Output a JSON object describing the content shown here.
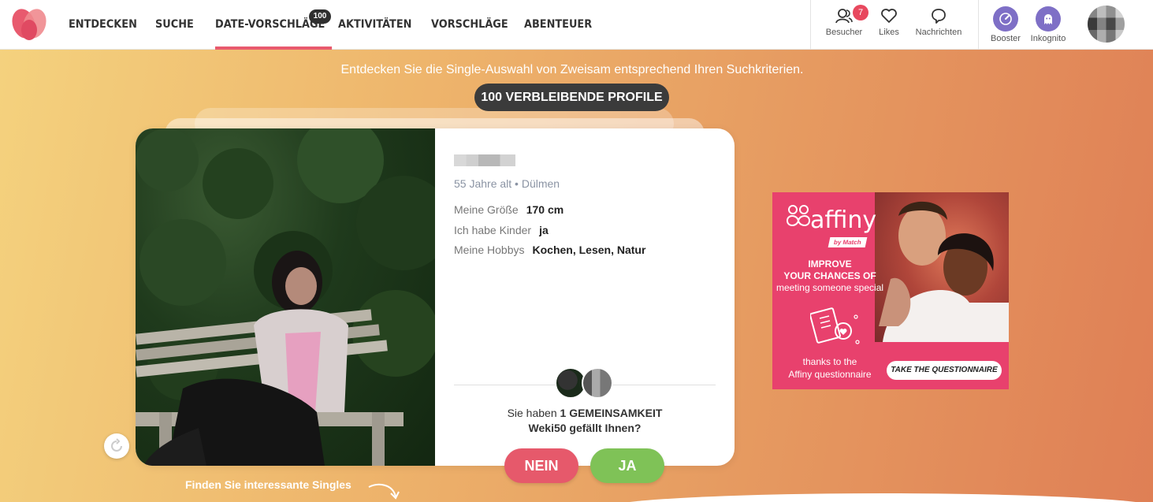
{
  "nav": {
    "items": [
      {
        "label": "ENTDECKEN"
      },
      {
        "label": "SUCHE"
      },
      {
        "label": "DATE-VORSCHLÄGE",
        "badge": "100",
        "active": true
      },
      {
        "label": "AKTIVITÄTEN"
      },
      {
        "label": "VORSCHLÄGE"
      },
      {
        "label": "ABENTEUER"
      }
    ]
  },
  "toolbar": {
    "visitors_label": "Besucher",
    "visitors_count": "7",
    "likes_label": "Likes",
    "messages_label": "Nachrichten",
    "booster_label": "Booster",
    "incognito_label": "Inkognito"
  },
  "intro": {
    "text": "Entdecken Sie die Single-Auswahl von Zweisam entsprechend Ihren Suchkriterien.",
    "remaining": "100 VERBLEIBENDE PROFILE"
  },
  "profile": {
    "age_city": "55 Jahre alt • Dülmen",
    "attributes": [
      {
        "key": "Meine Größe",
        "value": "170 cm"
      },
      {
        "key": "Ich habe Kinder",
        "value": "ja"
      },
      {
        "key": "Meine Hobbys",
        "value": "Kochen, Lesen, Natur"
      }
    ],
    "common_prefix": "Sie haben ",
    "common_count": "1 GEMEINSAMKEIT",
    "question": "Weki50 gefällt Ihnen?"
  },
  "actions": {
    "no": "NEIN",
    "yes": "JA",
    "find_hint": "Finden Sie interessante Singles"
  },
  "ad": {
    "brand": "affiny",
    "by": "by Match",
    "headline1": "IMPROVE",
    "headline2": "YOUR CHANCES OF",
    "headline3": "meeting someone special",
    "small1": "thanks to the",
    "small2": "Affiny questionnaire",
    "cta": "TAKE THE QUESTIONNAIRE"
  },
  "colors": {
    "accent": "#e85a6e",
    "yes": "#7fc257",
    "no": "#e6596b",
    "booster": "#7e6fc6",
    "ad_bg": "#e8416d"
  }
}
